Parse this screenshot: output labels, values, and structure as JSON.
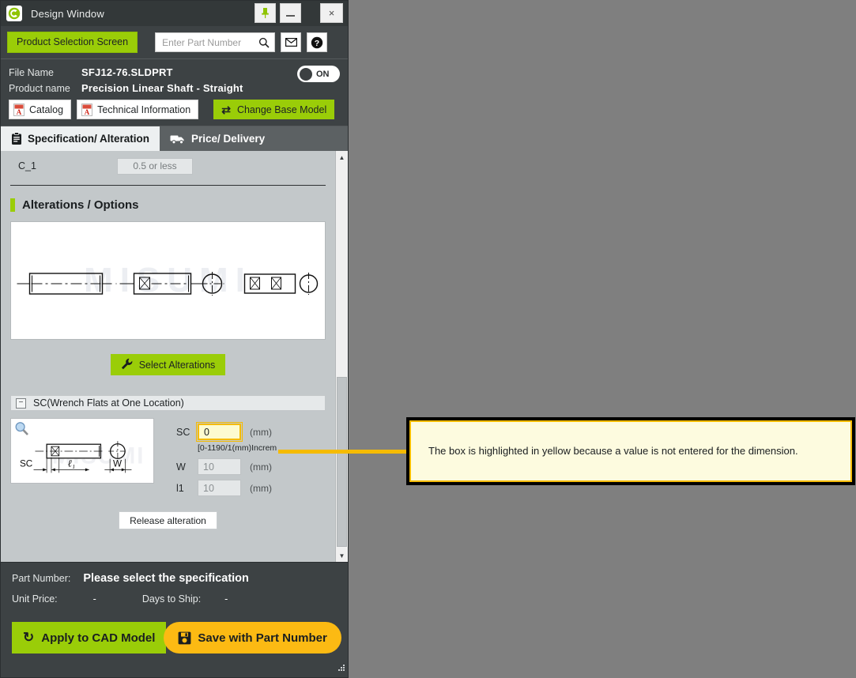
{
  "window": {
    "title": "Design Window",
    "logo_icon": "app-logo-icon",
    "buttons": {
      "pin": "pin-icon",
      "minimize": "minimize-icon",
      "close": "×"
    }
  },
  "toolbar": {
    "product_selection_label": "Product Selection Screen",
    "search": {
      "placeholder": "Enter Part Number",
      "value": "",
      "icon": "search-icon"
    },
    "mail_icon": "mail-icon",
    "help_icon": "help-icon"
  },
  "product_info": {
    "file_name_label": "File Name",
    "file_name_value": "SFJ12-76.SLDPRT",
    "product_name_label": "Product name",
    "product_name_value": "Precision Linear Shaft - Straight",
    "toggle_state": "ON",
    "catalog_label": "Catalog",
    "technical_information_label": "Technical Information",
    "change_base_model_label": "Change Base Model"
  },
  "tabs": [
    {
      "label": "Specification/ Alteration",
      "icon": "clipboard-icon",
      "active": true
    },
    {
      "label": "Price/ Delivery",
      "icon": "truck-icon",
      "active": false
    }
  ],
  "spec": {
    "c1_label": "C_1",
    "c1_value": "0.5 or less"
  },
  "alterations": {
    "section_title": "Alterations / Options",
    "drawing_watermark": "MISUMI",
    "select_button_label": "Select Alterations",
    "group": {
      "title": "SC(Wrench Flats at One Location)",
      "collapse_symbol": "−",
      "thumbnail_labels": [
        "SC",
        "ℓ₁",
        "W"
      ],
      "fields": [
        {
          "name": "SC",
          "value": "0",
          "unit": "(mm)",
          "highlighted": true,
          "range": "[0-1190/1(mm)Increm"
        },
        {
          "name": "W",
          "value": "10",
          "unit": "(mm)",
          "highlighted": false
        },
        {
          "name": "l1",
          "value": "10",
          "unit": "(mm)",
          "highlighted": false
        }
      ],
      "release_button_label": "Release alteration"
    }
  },
  "footer": {
    "part_number_label": "Part Number:",
    "part_number_value": "Please select the specification",
    "unit_price_label": "Unit Price:",
    "unit_price_value": "-",
    "days_to_ship_label": "Days to Ship:",
    "days_to_ship_value": "-",
    "apply_cad_label": "Apply to CAD Model",
    "save_part_label": "Save with Part Number"
  },
  "callout": {
    "text": "The box is highlighted in yellow because a value is not entered for the dimension."
  },
  "colors": {
    "accent_green": "#9acd08",
    "highlight_yellow": "#fdfbd0",
    "highlight_border": "#f5bb00",
    "save_orange": "#fcba13",
    "window_dark": "#3d4244",
    "content_gray": "#c3c8ca"
  }
}
